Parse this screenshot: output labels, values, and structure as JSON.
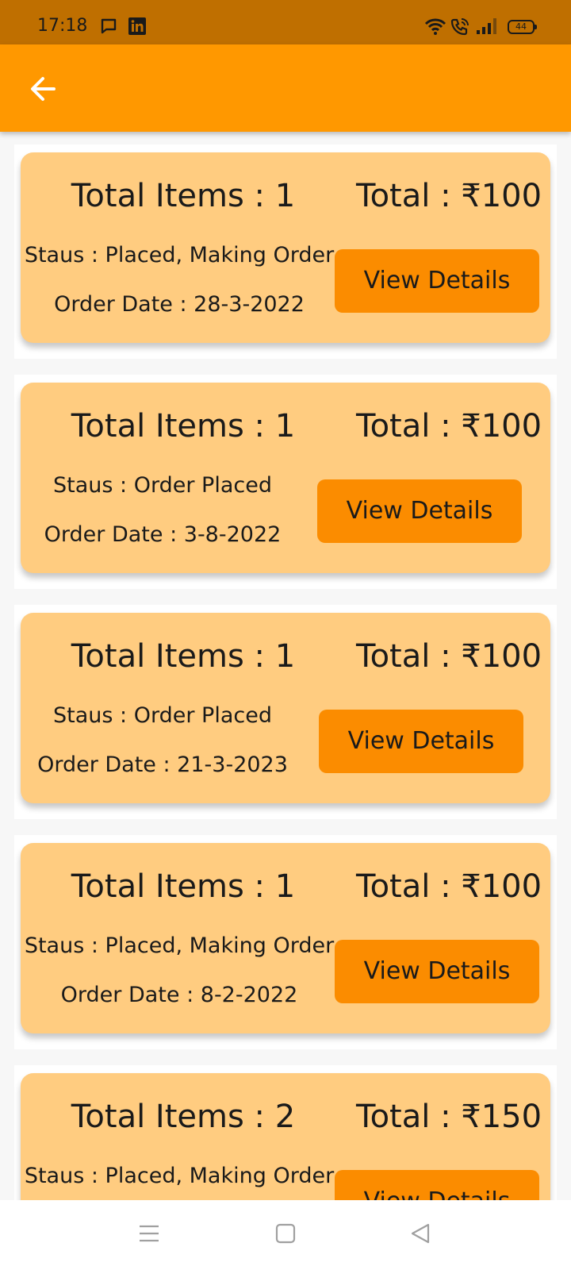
{
  "status_bar": {
    "time": "17:18",
    "battery": "44",
    "icons": [
      "message-icon",
      "linkedin-icon",
      "wifi-icon",
      "wifi-call-icon",
      "signal-icon",
      "battery-icon"
    ]
  },
  "app_bar": {
    "back_icon": "arrow-left-icon",
    "color": "#ff9800"
  },
  "orders": [
    {
      "items": "Total Items : 1",
      "total": "Total : ₹100",
      "status": "Staus : Placed, Making Order",
      "date": "Order Date : 28-3-2022",
      "button": "View Details"
    },
    {
      "items": "Total Items : 1",
      "total": "Total : ₹100",
      "status": "Staus : Order Placed",
      "date": "Order Date : 3-8-2022",
      "button": "View Details"
    },
    {
      "items": "Total Items : 1",
      "total": "Total : ₹100",
      "status": "Staus : Order Placed",
      "date": "Order Date : 21-3-2023",
      "button": "View Details"
    },
    {
      "items": "Total Items : 1",
      "total": "Total : ₹100",
      "status": "Staus : Placed, Making Order",
      "date": "Order Date : 8-2-2022",
      "button": "View Details"
    },
    {
      "items": "Total Items : 2",
      "total": "Total : ₹150",
      "status": "Staus : Placed, Making Order",
      "date": "",
      "button": "View Details"
    }
  ],
  "colors": {
    "card": "#ffcc80",
    "button": "#fb8c00",
    "status_bar": "#bf6f00"
  },
  "nav_bar": {
    "icons": [
      "menu-icon",
      "home-square-icon",
      "back-triangle-icon"
    ]
  }
}
